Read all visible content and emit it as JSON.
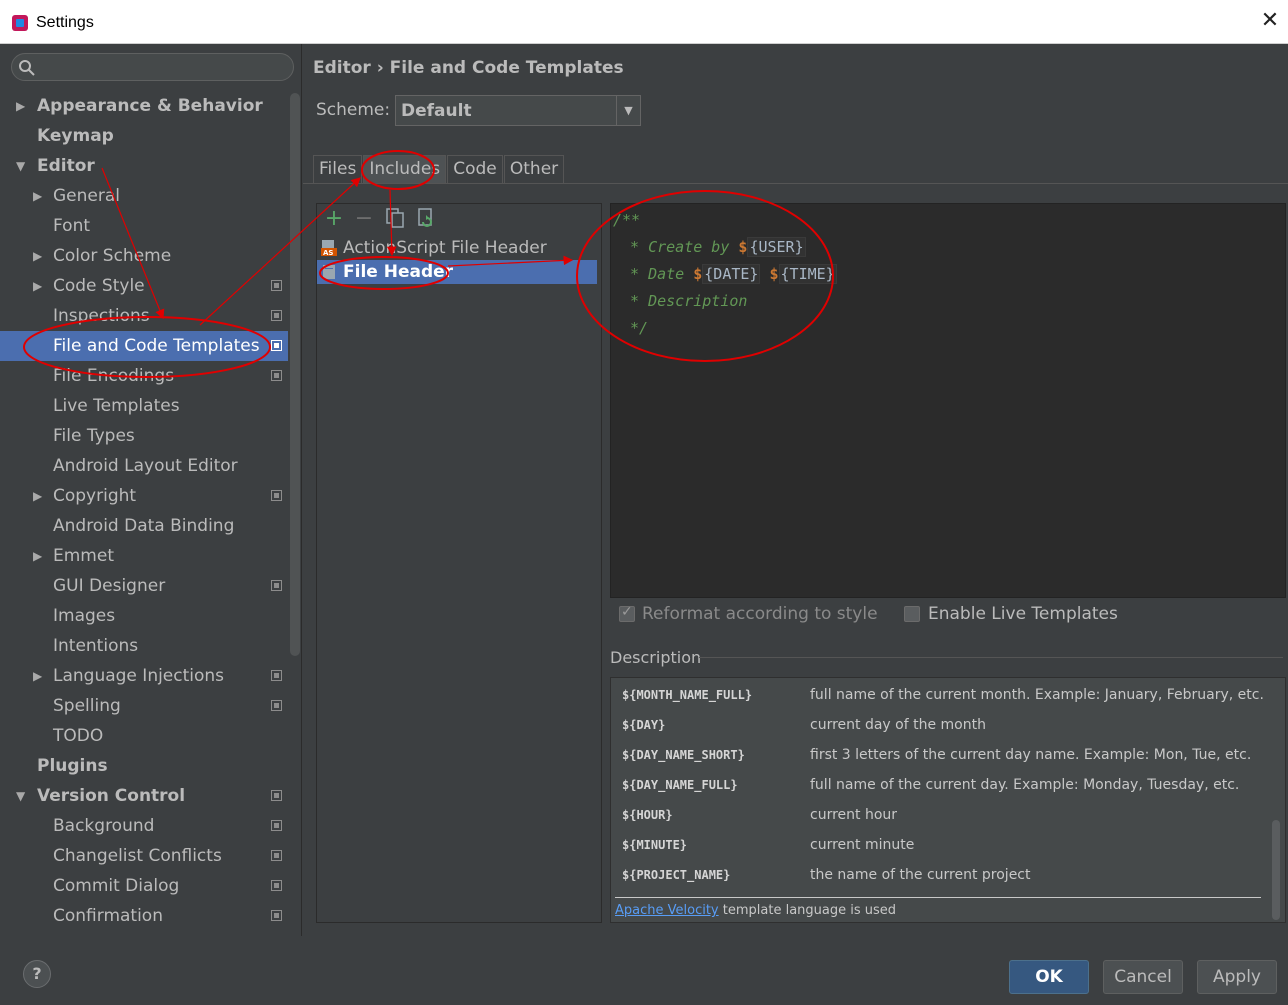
{
  "window": {
    "title": "Settings",
    "close_glyph": "✕"
  },
  "sidebar": {
    "search_placeholder": "",
    "items": [
      {
        "label": "Appearance & Behavior",
        "level": 0,
        "arrow": "▶",
        "project": false
      },
      {
        "label": "Keymap",
        "level": 0,
        "arrow": "",
        "project": false
      },
      {
        "label": "Editor",
        "level": 0,
        "arrow": "▼",
        "project": false
      },
      {
        "label": "General",
        "level": 1,
        "arrow": "▶",
        "project": false
      },
      {
        "label": "Font",
        "level": 1,
        "arrow": "",
        "project": false
      },
      {
        "label": "Color Scheme",
        "level": 1,
        "arrow": "▶",
        "project": false
      },
      {
        "label": "Code Style",
        "level": 1,
        "arrow": "▶",
        "project": true
      },
      {
        "label": "Inspections",
        "level": 1,
        "arrow": "",
        "project": true
      },
      {
        "label": "File and Code Templates",
        "level": 1,
        "arrow": "",
        "project": true,
        "selected": true
      },
      {
        "label": "File Encodings",
        "level": 1,
        "arrow": "",
        "project": true
      },
      {
        "label": "Live Templates",
        "level": 1,
        "arrow": "",
        "project": false
      },
      {
        "label": "File Types",
        "level": 1,
        "arrow": "",
        "project": false
      },
      {
        "label": "Android Layout Editor",
        "level": 1,
        "arrow": "",
        "project": false
      },
      {
        "label": "Copyright",
        "level": 1,
        "arrow": "▶",
        "project": true
      },
      {
        "label": "Android Data Binding",
        "level": 1,
        "arrow": "",
        "project": false
      },
      {
        "label": "Emmet",
        "level": 1,
        "arrow": "▶",
        "project": false
      },
      {
        "label": "GUI Designer",
        "level": 1,
        "arrow": "",
        "project": true
      },
      {
        "label": "Images",
        "level": 1,
        "arrow": "",
        "project": false
      },
      {
        "label": "Intentions",
        "level": 1,
        "arrow": "",
        "project": false
      },
      {
        "label": "Language Injections",
        "level": 1,
        "arrow": "▶",
        "project": true
      },
      {
        "label": "Spelling",
        "level": 1,
        "arrow": "",
        "project": true
      },
      {
        "label": "TODO",
        "level": 1,
        "arrow": "",
        "project": false
      },
      {
        "label": "Plugins",
        "level": 0,
        "arrow": "",
        "project": false
      },
      {
        "label": "Version Control",
        "level": 0,
        "arrow": "▼",
        "project": true
      },
      {
        "label": "Background",
        "level": 1,
        "arrow": "",
        "project": true
      },
      {
        "label": "Changelist Conflicts",
        "level": 1,
        "arrow": "",
        "project": true
      },
      {
        "label": "Commit Dialog",
        "level": 1,
        "arrow": "",
        "project": true
      },
      {
        "label": "Confirmation",
        "level": 1,
        "arrow": "",
        "project": true
      }
    ]
  },
  "main": {
    "breadcrumb": "Editor › File and Code Templates",
    "scheme_label": "Scheme:",
    "scheme_value": "Default",
    "tabs": [
      {
        "label": "Files",
        "active": false
      },
      {
        "label": "Includes",
        "active": true
      },
      {
        "label": "Code",
        "active": false
      },
      {
        "label": "Other",
        "active": false
      }
    ],
    "toolbar": {
      "add": "+",
      "remove": "−"
    },
    "templates": [
      {
        "label": "ActionScript File Header",
        "selected": false
      },
      {
        "label": "File Header",
        "selected": true
      }
    ],
    "editor": {
      "line1": "/**",
      "line2_prefix": " * Create by ",
      "line2_var": "{USER}",
      "line3_prefix": " * Date ",
      "line3_var1": "{DATE}",
      "line3_var2": "{TIME}",
      "line4": " * Description",
      "line5": " */",
      "dollar": "$"
    },
    "reformat_label": "Reformat according to style",
    "reformat_checked": true,
    "live_templates_label": "Enable Live Templates",
    "live_templates_checked": false,
    "description_title": "Description",
    "description_rows": [
      {
        "key": "${MONTH_NAME_FULL}",
        "value": "full name of the current month. Example: January, February, etc."
      },
      {
        "key": "${DAY}",
        "value": "current day of the month"
      },
      {
        "key": "${DAY_NAME_SHORT}",
        "value": "first 3 letters of the current day name. Example: Mon, Tue, etc."
      },
      {
        "key": "${DAY_NAME_FULL}",
        "value": "full name of the current day. Example: Monday, Tuesday, etc."
      },
      {
        "key": "${HOUR}",
        "value": "current hour"
      },
      {
        "key": "${MINUTE}",
        "value": "current minute"
      },
      {
        "key": "${PROJECT_NAME}",
        "value": "the name of the current project"
      }
    ],
    "velocity_link": "Apache Velocity",
    "velocity_text": " template language is used"
  },
  "footer": {
    "help": "?",
    "ok": "OK",
    "cancel": "Cancel",
    "apply": "Apply"
  },
  "colors": {
    "background": "#3c3f41",
    "selection": "#4b6eaf",
    "annotation_red": "#e00000",
    "comment_green": "#629755"
  }
}
